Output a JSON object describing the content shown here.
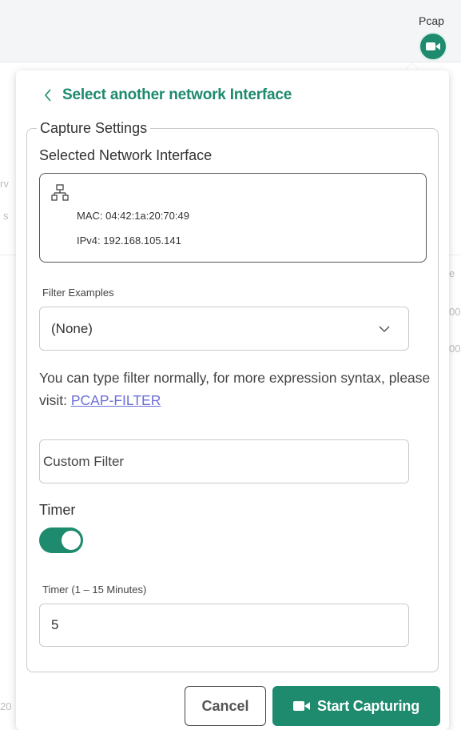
{
  "topbar": {
    "pcap_label": "Pcap",
    "pcap_icon": "video-camera-icon"
  },
  "background_fragments": {
    "left_rv": "rv",
    "left_s": "s",
    "right_e": "e",
    "right_00_a": "00",
    "right_00_b": "00",
    "left_20": "20"
  },
  "panel": {
    "back_label": "Select another network Interface",
    "capture_legend": "Capture Settings",
    "selected_interface_title": "Selected Network Interface",
    "interface": {
      "icon": "network-icon",
      "mac": "MAC: 04:42:1a:20:70:49",
      "ipv4": "IPv4: 192.168.105.141"
    },
    "filter_examples_label": "Filter Examples",
    "filter_examples_value": "(None)",
    "help_text": "You can type filter normally, for more expression syntax, please visit: ",
    "help_link": "PCAP-FILTER",
    "custom_filter_placeholder": "Custom Filter",
    "custom_filter_value": "",
    "timer_label": "Timer",
    "timer_enabled": true,
    "timer_range_label": "Timer (1 – 15 Minutes)",
    "timer_value": "5",
    "cancel_label": "Cancel",
    "start_label": "Start Capturing"
  },
  "colors": {
    "accent": "#1e8a6e",
    "link": "#6b6fd6"
  }
}
